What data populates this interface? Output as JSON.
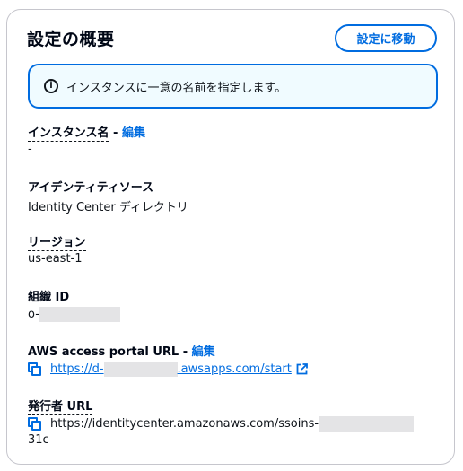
{
  "card": {
    "title": "設定の概要",
    "move_button": "設定に移動"
  },
  "alert": {
    "icon": "info-icon",
    "icon_glyph": "i",
    "text": "インスタンスに一意の名前を指定します。"
  },
  "fields": {
    "instance_name": {
      "label": "インスタンス名",
      "separator": " - ",
      "edit": "編集",
      "value": "-"
    },
    "identity_source": {
      "label": "アイデンティティソース",
      "value": "Identity Center ディレクトリ"
    },
    "region": {
      "label": "リージョン",
      "value": "us-east-1"
    },
    "org_id": {
      "label": "組織 ID",
      "value_prefix": "o-"
    },
    "access_portal": {
      "label": "AWS access portal URL",
      "separator": " - ",
      "edit": "編集",
      "url_prefix": "https://d-",
      "url_suffix": ".awsapps.com/start",
      "icon": "external-link-icon"
    },
    "issuer": {
      "label": "発行者 URL",
      "url_prefix": "https://identitycenter.amazonaws.com/ssoins-",
      "url_suffix": "31c"
    }
  },
  "colors": {
    "accent": "#006ce0",
    "alert_bg": "#f0fbff",
    "text": "#0f141a",
    "border": "#c6c6cd",
    "redaction": "#e4e4e6"
  }
}
